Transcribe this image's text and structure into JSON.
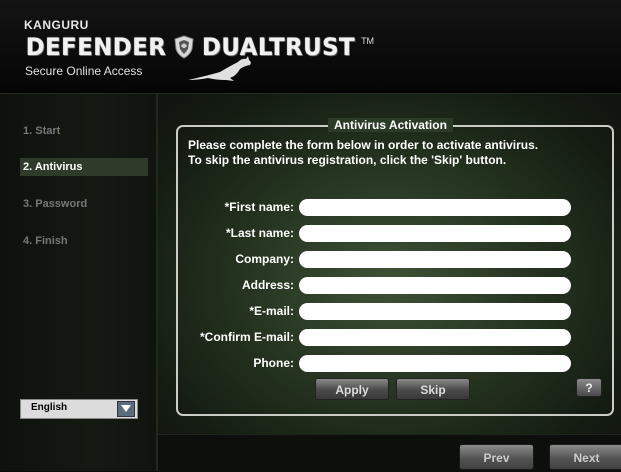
{
  "header": {
    "brand_top": "KANGURU",
    "brand_left": "DEFENDER",
    "brand_right": "DUALTRUST",
    "trademark": "TM",
    "tagline": "Secure Online Access"
  },
  "sidebar": {
    "steps": [
      {
        "label": "1. Start",
        "active": false
      },
      {
        "label": "2. Antivirus",
        "active": true
      },
      {
        "label": "3. Password",
        "active": false
      },
      {
        "label": "4. Finish",
        "active": false
      }
    ],
    "language": {
      "selected": "English"
    }
  },
  "form": {
    "title": "Antivirus Activation",
    "instruction_line1": "Please complete the form below in order to activate antivirus.",
    "instruction_line2": "To skip the antivirus registration, click the 'Skip' button.",
    "fields": [
      {
        "label": "*First name:",
        "value": ""
      },
      {
        "label": "*Last name:",
        "value": ""
      },
      {
        "label": "Company:",
        "value": ""
      },
      {
        "label": "Address:",
        "value": ""
      },
      {
        "label": "*E-mail:",
        "value": ""
      },
      {
        "label": "*Confirm E-mail:",
        "value": ""
      },
      {
        "label": "Phone:",
        "value": ""
      }
    ],
    "apply_label": "Apply",
    "skip_label": "Skip",
    "help_label": "?"
  },
  "footer": {
    "prev_label": "Prev",
    "next_label": "Next"
  },
  "colors": {
    "accent": "#2e3a2a",
    "panel_border": "#c9ccc5"
  }
}
